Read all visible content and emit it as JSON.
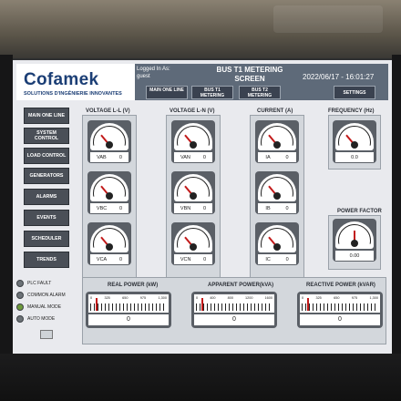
{
  "header": {
    "logo": "Cofamek",
    "logo_tagline": "SOLUTIONS D'INGÉNIERIE INNOVANTES",
    "logged_in": "Logged In As:",
    "user": "guest",
    "title": "BUS T1 METERING SCREEN",
    "datetime": "2022/06/17 - 16:01:27"
  },
  "nav": {
    "main_one_line": "MAIN ONE LINE",
    "bus_t1": "BUS T1 METERING",
    "bus_t2": "BUS T2 METERING",
    "settings": "SETTINGS"
  },
  "sidebar": {
    "items": [
      "MAIN ONE LINE",
      "SYSTEM CONTROL",
      "LOAD CONTROL",
      "GENERATORS",
      "ALARMS",
      "EVENTS",
      "SCHEDULER",
      "TRENDS"
    ]
  },
  "status": {
    "plc_fault": "PLC FAULT",
    "common_alarm": "COMMON ALARM",
    "manual_mode": "MANUAL MODE",
    "auto_mode": "AUTO MODE"
  },
  "sections": {
    "voltage_ll": "VOLTAGE L-L (V)",
    "voltage_ln": "VOLTAGE L-N (V)",
    "current": "CURRENT (A)",
    "frequency": "FREQUENCY (Hz)",
    "power_factor": "POWER FACTOR",
    "real_power": "REAL POWER (kW)",
    "apparent_power": "APPARENT POWER(kVA)",
    "reactive_power": "REACTIVE POWER (kVAR)"
  },
  "gauges": {
    "vab": {
      "label": "VAB",
      "value": "0"
    },
    "vbc": {
      "label": "VBC",
      "value": "0"
    },
    "vca": {
      "label": "VCA",
      "value": "0"
    },
    "van": {
      "label": "VAN",
      "value": "0"
    },
    "vbn": {
      "label": "VBN",
      "value": "0"
    },
    "vcn": {
      "label": "VCN",
      "value": "0"
    },
    "ia": {
      "label": "IA",
      "value": "0"
    },
    "ib": {
      "label": "IB",
      "value": "0"
    },
    "ic": {
      "label": "IC",
      "value": "0"
    },
    "freq": {
      "value": "0.0"
    },
    "pf": {
      "value": "0.00"
    }
  },
  "power_meters": {
    "real": {
      "scale": [
        "0",
        "325",
        "650",
        "975",
        "1,300"
      ],
      "value": "0"
    },
    "apparent": {
      "scale": [
        "0",
        "400",
        "800",
        "1200",
        "1600"
      ],
      "value": "0"
    },
    "reactive": {
      "scale": [
        "0",
        "325",
        "650",
        "975",
        "1,300"
      ],
      "value": "0"
    }
  },
  "colors": {
    "header": "#5e6a79",
    "brand": "#1b3e75",
    "button": "#4a4f57",
    "needle": "#c21a1a",
    "lamp_green": "#6d9a3c"
  }
}
